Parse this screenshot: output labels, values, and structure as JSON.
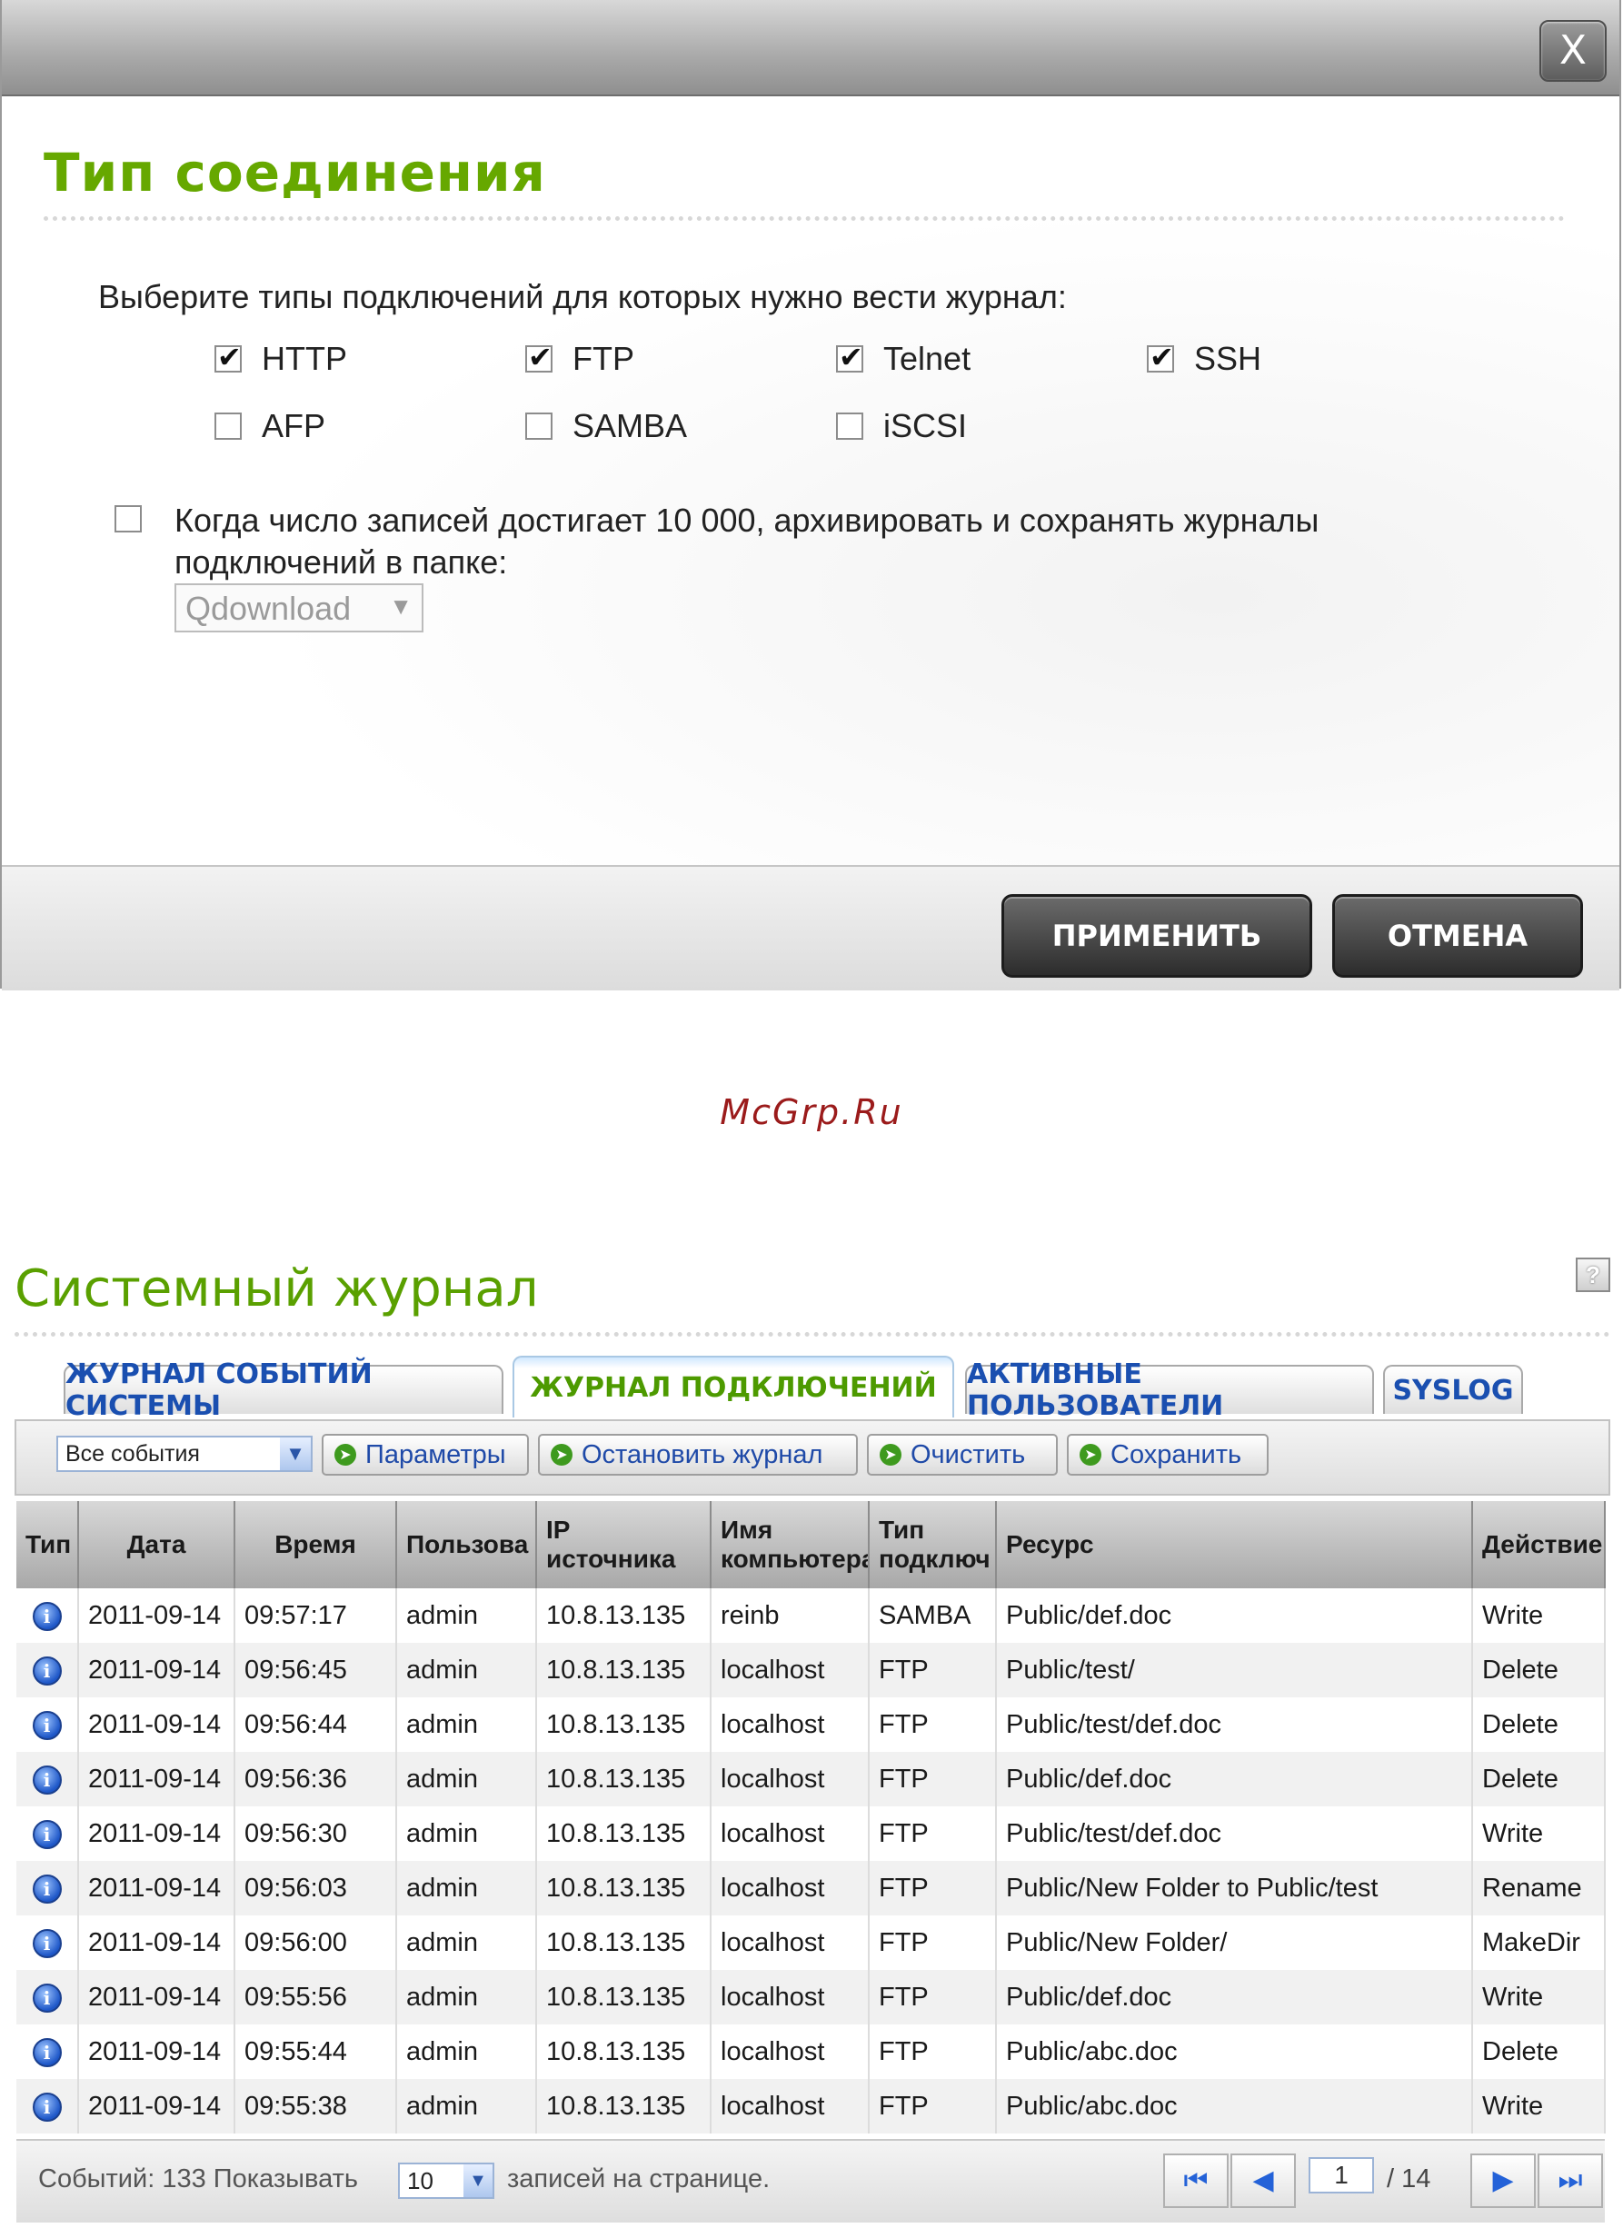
{
  "dialog": {
    "close_glyph": "X",
    "title": "Тип соединения",
    "prompt": "Выберите типы подключений для которых нужно вести журнал:",
    "types": [
      {
        "label": "HTTP",
        "checked": true
      },
      {
        "label": "FTP",
        "checked": true
      },
      {
        "label": "Telnet",
        "checked": true
      },
      {
        "label": "SSH",
        "checked": true
      },
      {
        "label": "AFP",
        "checked": false
      },
      {
        "label": "SAMBA",
        "checked": false
      },
      {
        "label": "iSCSI",
        "checked": false
      }
    ],
    "archive_checked": false,
    "archive_text": "Когда число записей достигает 10 000, архивировать и сохранять журналы подключений в папке:",
    "folder_value": "Qdownload",
    "apply_label": "ПРИМЕНИТЬ",
    "cancel_label": "ОТМЕНА"
  },
  "watermark": "McGrp.Ru",
  "syslog": {
    "title": "Системный журнал",
    "help_glyph": "?",
    "tabs": [
      {
        "label": "ЖУРНАЛ СОБЫТИЙ СИСТЕМЫ",
        "active": false
      },
      {
        "label": "ЖУРНАЛ ПОДКЛЮЧЕНИЙ",
        "active": true
      },
      {
        "label": "АКТИВНЫЕ ПОЛЬЗОВАТЕЛИ",
        "active": false
      },
      {
        "label": "SYSLOG",
        "active": false
      }
    ],
    "toolbar": {
      "filter_value": "Все события",
      "buttons": [
        "Параметры",
        "Остановить журнал",
        "Очистить",
        "Сохранить"
      ]
    },
    "columns": [
      "Тип",
      "Дата",
      "Время",
      "Пользова",
      "IP источника",
      "Имя компьютера",
      "Тип подключ",
      "Ресурс",
      "Действие"
    ],
    "rows": [
      {
        "date": "2011-09-14",
        "time": "09:57:17",
        "user": "admin",
        "ip": "10.8.13.135",
        "host": "reinb",
        "conn": "SAMBA",
        "resource": "Public/def.doc",
        "action": "Write"
      },
      {
        "date": "2011-09-14",
        "time": "09:56:45",
        "user": "admin",
        "ip": "10.8.13.135",
        "host": "localhost",
        "conn": "FTP",
        "resource": "Public/test/",
        "action": "Delete"
      },
      {
        "date": "2011-09-14",
        "time": "09:56:44",
        "user": "admin",
        "ip": "10.8.13.135",
        "host": "localhost",
        "conn": "FTP",
        "resource": "Public/test/def.doc",
        "action": "Delete"
      },
      {
        "date": "2011-09-14",
        "time": "09:56:36",
        "user": "admin",
        "ip": "10.8.13.135",
        "host": "localhost",
        "conn": "FTP",
        "resource": "Public/def.doc",
        "action": "Delete"
      },
      {
        "date": "2011-09-14",
        "time": "09:56:30",
        "user": "admin",
        "ip": "10.8.13.135",
        "host": "localhost",
        "conn": "FTP",
        "resource": "Public/test/def.doc",
        "action": "Write"
      },
      {
        "date": "2011-09-14",
        "time": "09:56:03",
        "user": "admin",
        "ip": "10.8.13.135",
        "host": "localhost",
        "conn": "FTP",
        "resource": "Public/New Folder to Public/test",
        "action": "Rename"
      },
      {
        "date": "2011-09-14",
        "time": "09:56:00",
        "user": "admin",
        "ip": "10.8.13.135",
        "host": "localhost",
        "conn": "FTP",
        "resource": "Public/New Folder/",
        "action": "MakeDir"
      },
      {
        "date": "2011-09-14",
        "time": "09:55:56",
        "user": "admin",
        "ip": "10.8.13.135",
        "host": "localhost",
        "conn": "FTP",
        "resource": "Public/def.doc",
        "action": "Write"
      },
      {
        "date": "2011-09-14",
        "time": "09:55:44",
        "user": "admin",
        "ip": "10.8.13.135",
        "host": "localhost",
        "conn": "FTP",
        "resource": "Public/abc.doc",
        "action": "Delete"
      },
      {
        "date": "2011-09-14",
        "time": "09:55:38",
        "user": "admin",
        "ip": "10.8.13.135",
        "host": "localhost",
        "conn": "FTP",
        "resource": "Public/abc.doc",
        "action": "Write"
      }
    ],
    "footer": {
      "events_text": "Событий: 133 Показывать",
      "per_page_value": "10",
      "per_page_suffix": "записей на странице.",
      "current_page": "1",
      "total_pages_text": "/ 14"
    }
  }
}
